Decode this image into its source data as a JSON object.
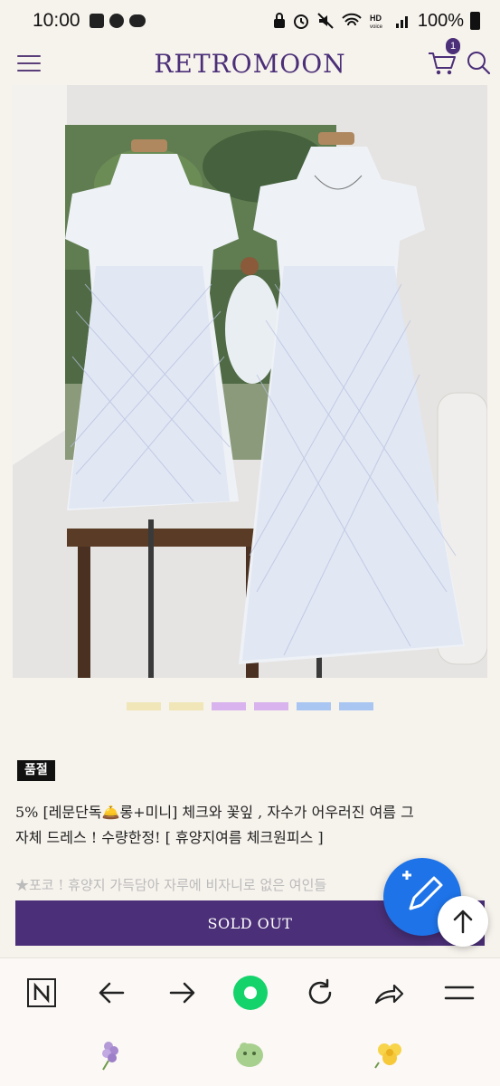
{
  "status_bar": {
    "time": "10:00",
    "left_icons": [
      "image-icon",
      "talk-icon",
      "chat-icon"
    ],
    "right_icons": [
      "lock-icon",
      "alarm-icon",
      "mute-icon",
      "wifi-icon",
      "hd-voice-icon",
      "signal-icon"
    ],
    "battery": "100%"
  },
  "header": {
    "logo": "RETROMOON",
    "cart_count": "1",
    "icons": [
      "menu-icon",
      "cart-icon",
      "search-icon"
    ]
  },
  "carousel": {
    "dot_colors": [
      "#f1e6b8",
      "#f1e6b8",
      "#d9b3ee",
      "#d9b3ee",
      "#a9c6f2",
      "#a9c6f2"
    ],
    "image_alt": "two floral check dresses on mannequins"
  },
  "product": {
    "status_tag": "품절",
    "title_line1": "5% [레문단독🛎️롱+미니] 체크와 꽃잎 , 자수가 어우러진 여름 그",
    "title_line2": "자체 드레스 ! 수량한정! [ 휴양지여름 체크원피스 ]",
    "description_preview": "★포코 ! 휴양지 가득담아 자루에 비자니로 없은 여인들"
  },
  "actions": {
    "sold_out_label": "SOLD OUT"
  },
  "colors": {
    "brand": "#4b2f78",
    "fab": "#1e73e8",
    "background": "#f6f2ec"
  },
  "browser_bar": {
    "icons": [
      "naver-n-icon",
      "back-arrow-icon",
      "forward-arrow-icon",
      "home-green-icon",
      "refresh-icon",
      "share-icon",
      "menu-icon"
    ]
  },
  "bottom_icons": [
    "lilac-flower-icon",
    "green-blob-icon",
    "yellow-flower-icon"
  ]
}
